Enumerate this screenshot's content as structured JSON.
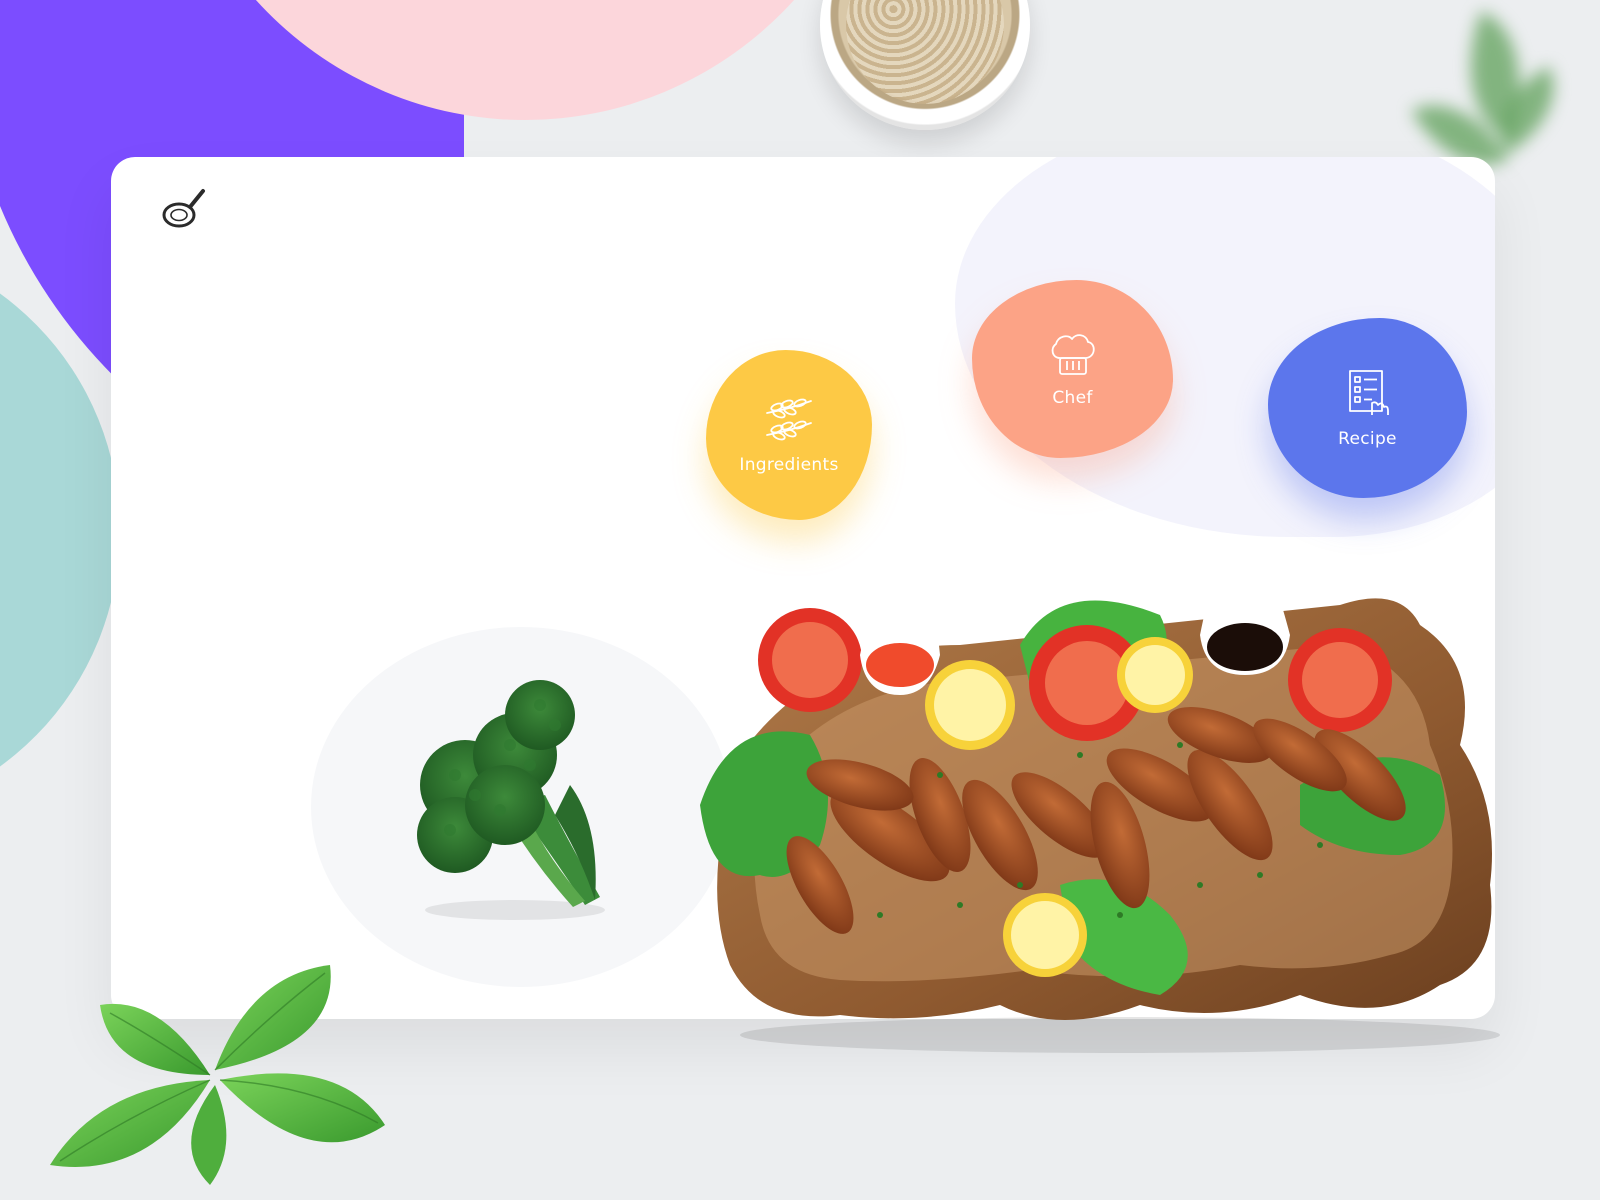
{
  "nav": {
    "ingredients_label": "Ingredients",
    "chef_label": "Chef",
    "recipe_label": "Recipe"
  },
  "colors": {
    "ingredients": "#fdc945",
    "chef": "#fca386",
    "recipe": "#5c76ec",
    "accent_purple": "#7c4dff",
    "accent_pink": "#fcd6db",
    "accent_teal": "#a9d8d7"
  },
  "icons": {
    "logo": "frying-pan-icon",
    "ingredients": "wheat-icon",
    "chef": "chef-hat-icon",
    "recipe": "recipe-list-icon"
  }
}
